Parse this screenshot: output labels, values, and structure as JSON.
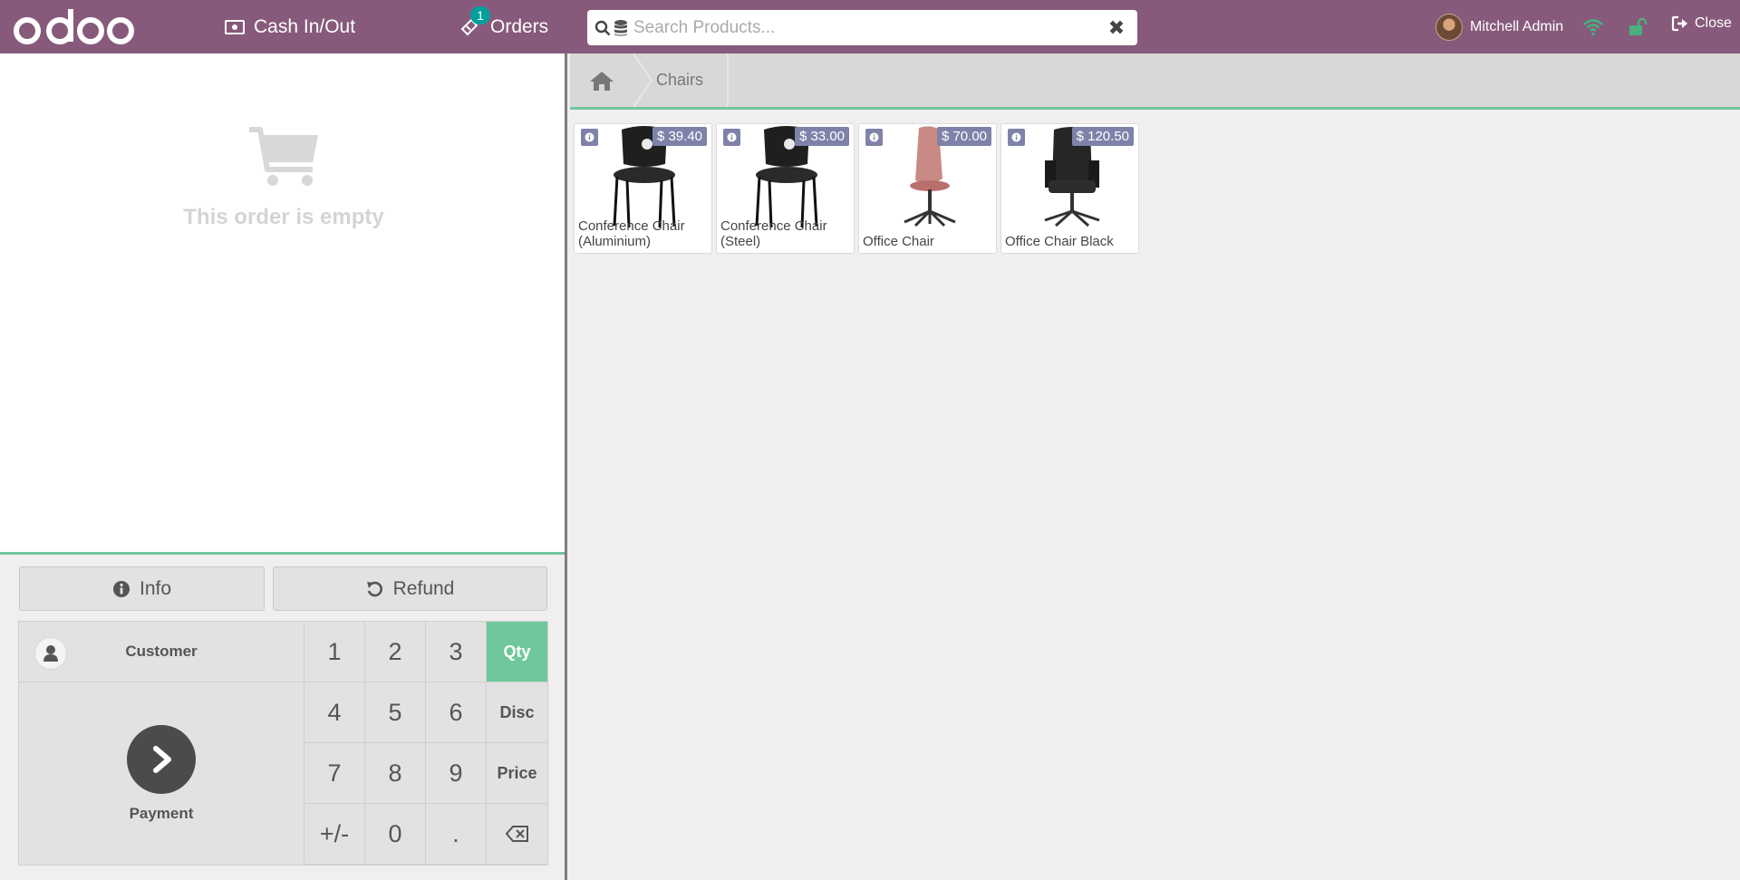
{
  "header": {
    "logo_text": "odoo",
    "cash_label": "Cash In/Out",
    "orders_label": "Orders",
    "orders_count": "1",
    "search_placeholder": "Search Products...",
    "search_value": "",
    "user_name": "Mitchell Admin",
    "close_label": "Close"
  },
  "order": {
    "empty_text": "This order is empty"
  },
  "controls": {
    "info_label": "Info",
    "refund_label": "Refund",
    "customer_label": "Customer",
    "payment_label": "Payment",
    "keys": [
      "1",
      "2",
      "3",
      "4",
      "5",
      "6",
      "7",
      "8",
      "9",
      "+/-",
      "0",
      "."
    ],
    "modes": [
      "Qty",
      "Disc",
      "Price"
    ],
    "active_mode": "Qty"
  },
  "breadcrumbs": {
    "category": "Chairs"
  },
  "products": [
    {
      "name": "Conference Chair (Aluminium)",
      "price": "$ 39.40",
      "chair": "conference"
    },
    {
      "name": "Conference Chair (Steel)",
      "price": "$ 33.00",
      "chair": "conference"
    },
    {
      "name": "Office Chair",
      "price": "$ 70.00",
      "chair": "office-pink"
    },
    {
      "name": "Office Chair Black",
      "price": "$ 120.50",
      "chair": "office-black"
    }
  ],
  "colors": {
    "brand": "#875a7b",
    "accent": "#6ec89b",
    "badge": "#00a09d",
    "price_tag": "#7f82a8",
    "connection": "#49b07c"
  },
  "icons": {
    "cash": "money-bill-icon",
    "orders": "ticket-icon",
    "search": "search-icon",
    "database": "database-icon",
    "clear": "close-icon",
    "wifi": "wifi-icon",
    "lock": "unlock-icon",
    "close": "sign-out-icon",
    "cart": "shopping-cart-icon",
    "home": "home-icon"
  }
}
